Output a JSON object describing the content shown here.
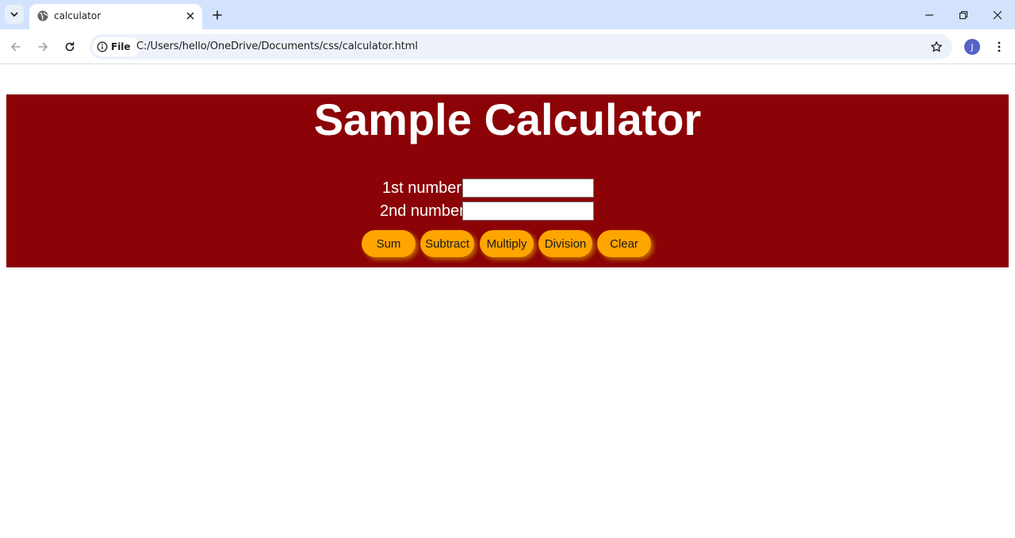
{
  "browser": {
    "tab": {
      "title": "calculator"
    },
    "address_bar": {
      "site_chip": "File",
      "url": "C:/Users/hello/OneDrive/Documents/css/calculator.html"
    },
    "profile_initial": "J"
  },
  "page": {
    "title": "Sample Calculator",
    "fields": [
      {
        "label": "1st number",
        "value": ""
      },
      {
        "label": "2nd number",
        "value": ""
      }
    ],
    "buttons": [
      "Sum",
      "Subtract",
      "Multiply",
      "Division",
      "Clear"
    ]
  },
  "colors": {
    "panel_background": "#8b0306",
    "button_background": "#ffa500",
    "title_text": "#ffffff"
  },
  "icons": {
    "tab_search": "chevron-down-icon",
    "favicon": "globe-icon",
    "tab_close": "close-icon",
    "new_tab": "plus-icon",
    "back": "back-arrow-icon",
    "forward": "forward-arrow-icon",
    "reload": "reload-icon",
    "site_info": "info-icon",
    "bookmark": "star-icon",
    "menu": "more-vert-icon",
    "minimize": "minimize-icon",
    "restore": "restore-icon",
    "close_window": "close-window-icon"
  }
}
